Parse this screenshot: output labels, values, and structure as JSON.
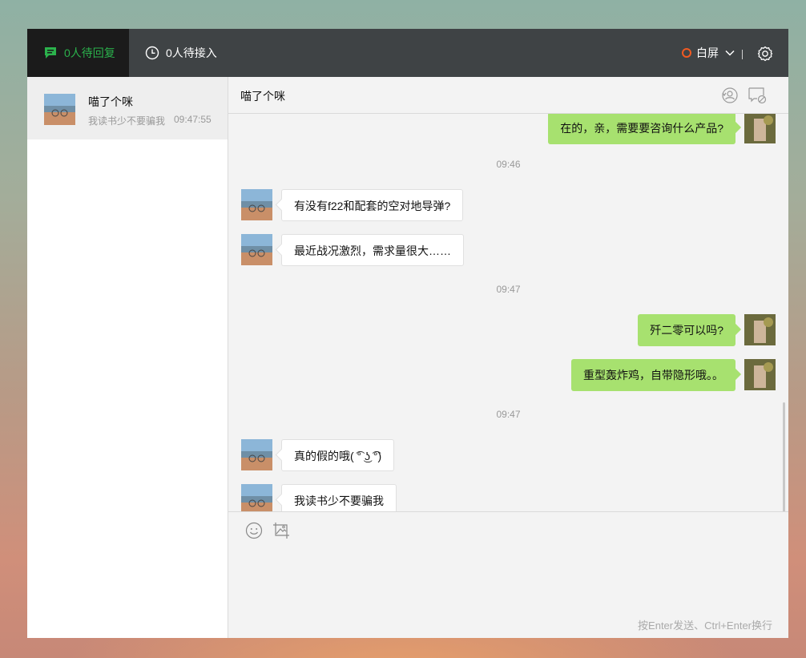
{
  "topbar": {
    "tabs": [
      {
        "label": "0人待回复",
        "icon": "chat-bubble-icon",
        "active": true
      },
      {
        "label": "0人待接入",
        "icon": "clock-icon",
        "active": false
      }
    ],
    "status_label": "白屏",
    "settings_icon": "gear-icon"
  },
  "conversation_list": [
    {
      "name": "喵了个咪",
      "last_message": "我读书少不要骗我",
      "time": "09:47:55",
      "selected": true
    }
  ],
  "chat": {
    "title": "喵了个咪",
    "header_icons": [
      "transfer-user-icon",
      "end-chat-icon"
    ],
    "messages": [
      {
        "type": "out",
        "text": "在的，亲，需要要咨询什么产品?"
      },
      {
        "type": "time",
        "text": "09:46"
      },
      {
        "type": "in",
        "text": "有没有f22和配套的空对地导弹?"
      },
      {
        "type": "in",
        "text": "最近战况激烈，需求量很大……"
      },
      {
        "type": "time",
        "text": "09:47"
      },
      {
        "type": "out",
        "text": "歼二零可以吗?"
      },
      {
        "type": "out",
        "text": "重型轰炸鸡，自带隐形哦。。"
      },
      {
        "type": "time",
        "text": "09:47"
      },
      {
        "type": "in",
        "text": "真的假的哦( ͡° ͜ʖ ͡°)"
      },
      {
        "type": "in",
        "text": "我读书少不要骗我"
      }
    ]
  },
  "input": {
    "tools": [
      "emoji-icon",
      "image-icon"
    ],
    "hint": "按Enter发送、Ctrl+Enter换行"
  },
  "colors": {
    "accent_green": "#2bb24c",
    "outgoing_bubble": "#a7e16f",
    "status_ring": "#f25a22",
    "topbar": "#3f4345"
  }
}
